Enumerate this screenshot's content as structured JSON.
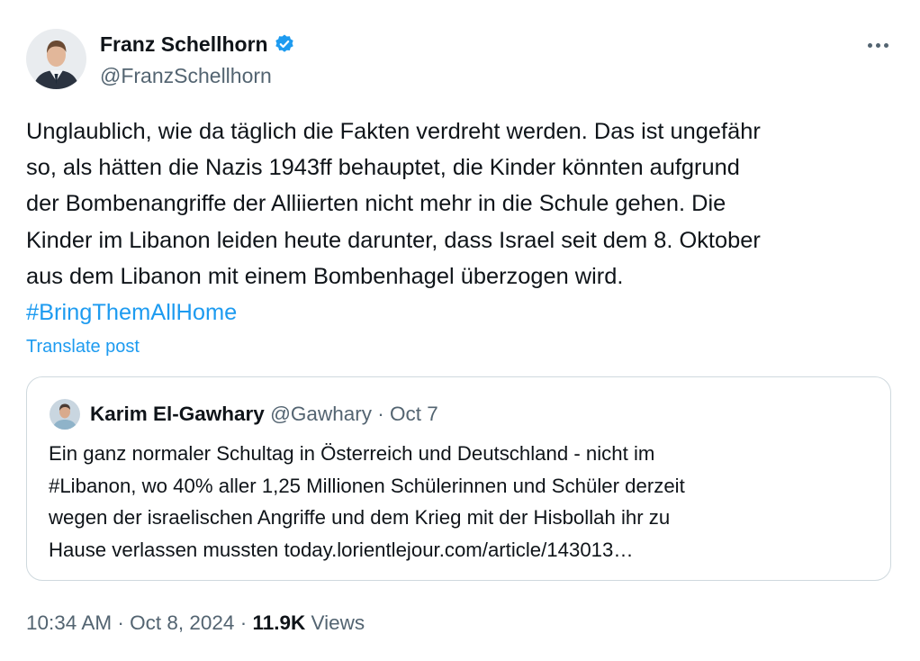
{
  "author": {
    "name": "Franz Schellhorn",
    "handle": "@FranzSchellhorn",
    "verified": true
  },
  "tweet": {
    "lines": [
      "Unglaublich, wie da täglich die Fakten verdreht werden. Das ist ungefähr",
      "so, als hätten die Nazis 1943ff behauptet, die Kinder könnten aufgrund",
      "der Bombenangriffe der Alliierten nicht mehr in die Schule gehen. Die",
      "Kinder im Libanon leiden heute darunter, dass Israel seit dem 8. Oktober",
      "aus dem Libanon mit einem Bombenhagel überzogen wird."
    ],
    "hashtag": "#BringThemAllHome",
    "translate_label": "Translate post"
  },
  "quote": {
    "name": "Karim El-Gawhary",
    "handle": "@Gawhary",
    "separator": "·",
    "date": "Oct 7",
    "lines": [
      "Ein ganz normaler Schultag in Österreich und Deutschland - nicht im",
      "#Libanon, wo 40% aller 1,25 Millionen Schülerinnen und Schüler derzeit",
      "wegen der israelischen Angriffe und dem Krieg mit der Hisbollah ihr zu",
      "Hause verlassen mussten today.lorientlejour.com/article/143013…"
    ]
  },
  "footer": {
    "time": "10:34 AM",
    "sep1": "·",
    "date": "Oct 8, 2024",
    "sep2": "·",
    "views_count": "11.9K",
    "views_label": "Views"
  },
  "colors": {
    "accent": "#1d9bf0",
    "secondary_text": "#536471",
    "border": "#cfd9de"
  }
}
